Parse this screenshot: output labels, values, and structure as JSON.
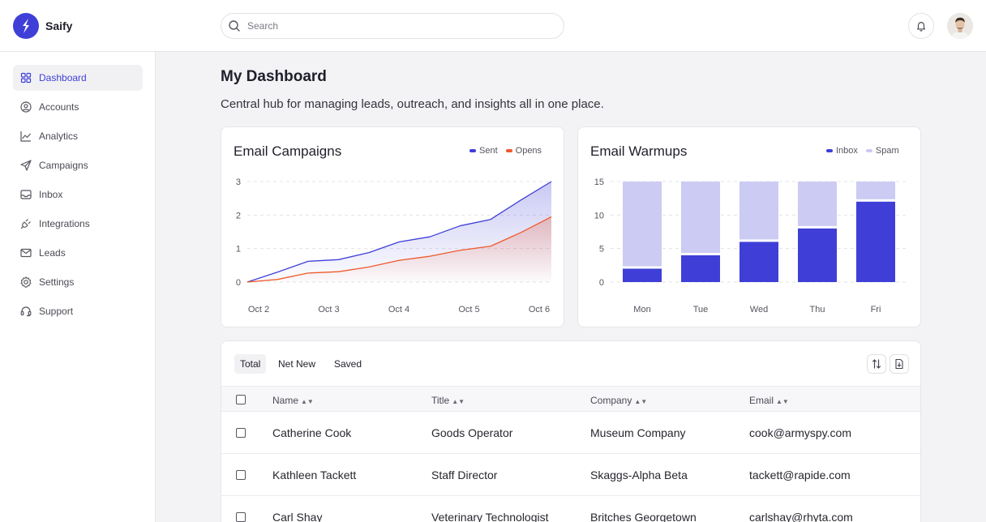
{
  "app": {
    "brand": "Saify",
    "search_placeholder": "Search"
  },
  "sidebar": {
    "items": [
      {
        "label": "Dashboard",
        "icon": "dashboard-grid-icon",
        "active": true
      },
      {
        "label": "Accounts",
        "icon": "user-circle-icon",
        "active": false
      },
      {
        "label": "Analytics",
        "icon": "line-chart-icon",
        "active": false
      },
      {
        "label": "Campaigns",
        "icon": "send-icon",
        "active": false
      },
      {
        "label": "Inbox",
        "icon": "inbox-icon",
        "active": false
      },
      {
        "label": "Integrations",
        "icon": "plug-icon",
        "active": false
      },
      {
        "label": "Leads",
        "icon": "mail-icon",
        "active": false
      },
      {
        "label": "Settings",
        "icon": "gear-icon",
        "active": false
      },
      {
        "label": "Support",
        "icon": "headset-icon",
        "active": false
      }
    ]
  },
  "main": {
    "title": "My Dashboard",
    "subtitle": "Central hub for managing leads, outreach, and insights all in one place."
  },
  "colors": {
    "accent": "#3f3fd8",
    "opens": "#ee5a2c",
    "spam": "#cbcbf3"
  },
  "chart_data": [
    {
      "type": "area",
      "title": "Email Campaigns",
      "x_labels": [
        "Oct 2",
        "Oct 3",
        "Oct 4",
        "Oct 5",
        "Oct 6"
      ],
      "ylim": [
        0,
        3
      ],
      "yticks": [
        "0",
        "1",
        "2",
        "3"
      ],
      "grid": true,
      "legend_position": "top-right",
      "series": [
        {
          "name": "Sent",
          "color": "#3f3fd8",
          "values": [
            0,
            0.3,
            0.62,
            0.67,
            0.88,
            1.2,
            1.35,
            1.68,
            1.87,
            2.45,
            3.0
          ]
        },
        {
          "name": "Opens",
          "color": "#ee5a2c",
          "values": [
            0,
            0.08,
            0.27,
            0.31,
            0.45,
            0.65,
            0.77,
            0.95,
            1.07,
            1.48,
            1.95
          ]
        }
      ]
    },
    {
      "type": "bar",
      "title": "Email Warmups",
      "categories": [
        "Mon",
        "Tue",
        "Wed",
        "Thu",
        "Fri"
      ],
      "ylim": [
        0,
        15
      ],
      "yticks": [
        "0",
        "5",
        "10",
        "15"
      ],
      "grid": true,
      "legend_position": "top-right",
      "stacked": true,
      "series": [
        {
          "name": "Inbox",
          "color": "#3f3fd8",
          "values": [
            2,
            4,
            6,
            8,
            12
          ]
        },
        {
          "name": "Spam",
          "color": "#cbcbf3",
          "values": [
            13,
            11,
            9,
            7,
            3
          ]
        }
      ]
    }
  ],
  "table": {
    "tabs": [
      {
        "label": "Total",
        "active": true
      },
      {
        "label": "Net New",
        "active": false
      },
      {
        "label": "Saved",
        "active": false
      }
    ],
    "columns": [
      "Name",
      "Title",
      "Company",
      "Email"
    ],
    "rows": [
      {
        "name": "Catherine Cook",
        "title": "Goods Operator",
        "company": "Museum Company",
        "email": "cook@armyspy.com"
      },
      {
        "name": "Kathleen Tackett",
        "title": "Staff Director",
        "company": "Skaggs-Alpha Beta",
        "email": "tackett@rapide.com"
      },
      {
        "name": "Carl Shay",
        "title": "Veterinary Technologist",
        "company": "Britches Georgetown",
        "email": "carlshay@rhyta.com"
      }
    ]
  }
}
